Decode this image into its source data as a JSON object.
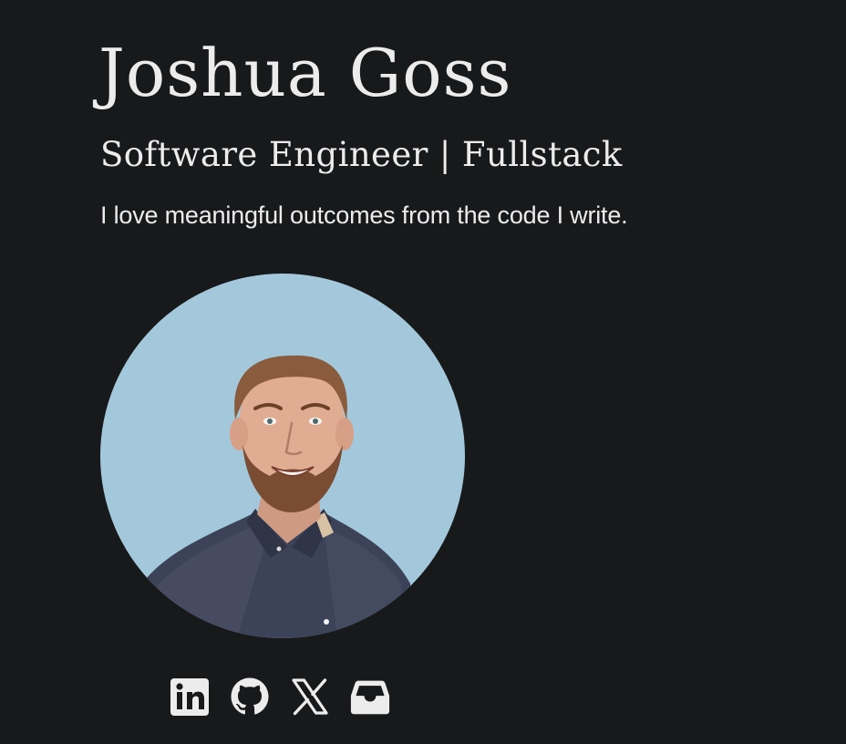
{
  "header": {
    "name": "Joshua Goss",
    "role": "Software Engineer | Fullstack",
    "tagline": "I love meaningful outcomes from the code I write."
  },
  "avatar": {
    "alt": "Joshua Goss"
  },
  "social_links": [
    {
      "icon": "linkedin-icon",
      "label": "LinkedIn"
    },
    {
      "icon": "github-icon",
      "label": "GitHub"
    },
    {
      "icon": "x-icon",
      "label": "X"
    },
    {
      "icon": "inbox-icon",
      "label": "Email"
    }
  ],
  "colors": {
    "background": "#18191b",
    "text": "#ececec",
    "avatar_background": "#a3c8dc"
  }
}
